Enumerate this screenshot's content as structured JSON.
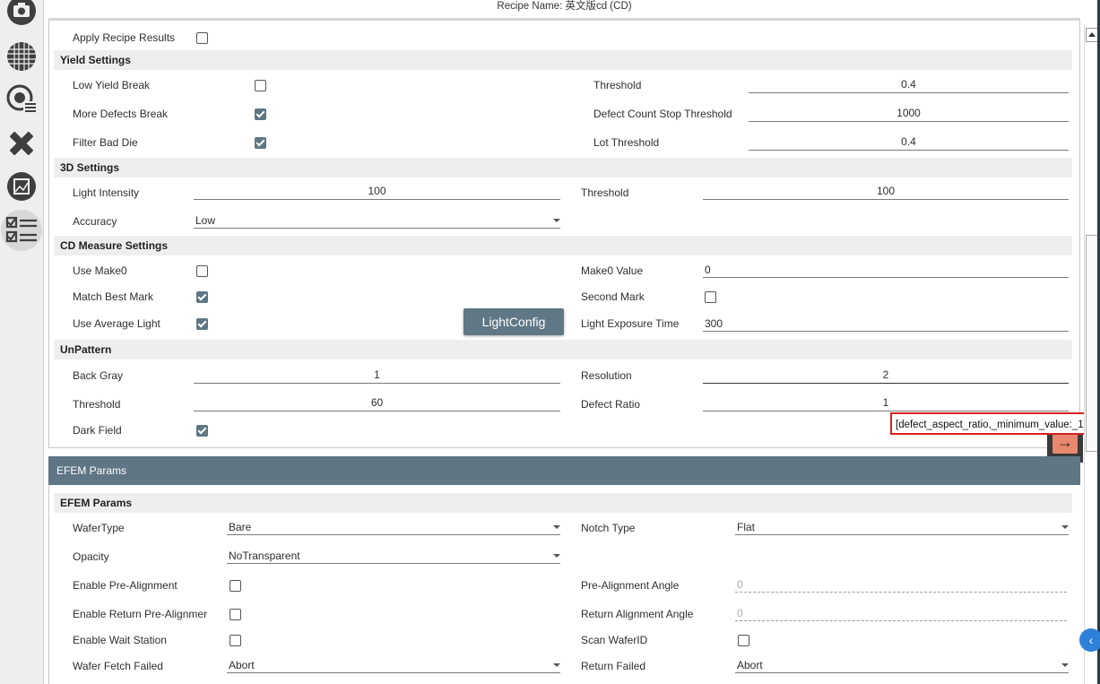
{
  "header": {
    "recipe_name": "Recipe Name: 英文版cd (CD)"
  },
  "sidebar": {
    "icons": [
      "camera-icon",
      "wafer-map-icon",
      "wafer-list-icon",
      "tools-icon",
      "image-icon",
      "checklist-icon"
    ],
    "active": "checklist-icon"
  },
  "recipe": {
    "apply_recipe_results": {
      "label": "Apply Recipe Results",
      "checked": false
    }
  },
  "yield_settings": {
    "title": "Yield Settings",
    "low_yield_break": {
      "label": "Low Yield Break",
      "checked": false
    },
    "more_defects_break": {
      "label": "More Defects Break",
      "checked": true
    },
    "filter_bad_die": {
      "label": "Filter Bad Die",
      "checked": true
    },
    "threshold": {
      "label": "Threshold",
      "value": "0.4"
    },
    "defect_count_stop_threshold": {
      "label": "Defect Count Stop Threshold",
      "value": "1000"
    },
    "lot_threshold": {
      "label": "Lot Threshold",
      "value": "0.4"
    }
  },
  "settings_3d": {
    "title": "3D Settings",
    "light_intensity": {
      "label": "Light Intensity",
      "value": "100"
    },
    "threshold": {
      "label": "Threshold",
      "value": "100"
    },
    "accuracy": {
      "label": "Accuracy",
      "value": "Low"
    }
  },
  "cd_measure": {
    "title": "CD Measure Settings",
    "use_make0": {
      "label": "Use Make0",
      "checked": false
    },
    "match_best_mark": {
      "label": "Match Best Mark",
      "checked": true
    },
    "use_average_light": {
      "label": "Use Average Light",
      "checked": true
    },
    "make0_value": {
      "label": "Make0 Value",
      "value": "0"
    },
    "second_mark": {
      "label": "Second Mark",
      "checked": false
    },
    "light_exposure_time": {
      "label": "Light Exposure Time",
      "value": "300"
    },
    "light_config_button": "LightConfig"
  },
  "unpattern": {
    "title": "UnPattern",
    "back_gray": {
      "label": "Back Gray",
      "value": "1"
    },
    "threshold": {
      "label": "Threshold",
      "value": "60"
    },
    "dark_field": {
      "label": "Dark Field",
      "checked": true
    },
    "resolution": {
      "label": "Resolution",
      "value": "2"
    },
    "defect_ratio": {
      "label": "Defect Ratio",
      "value": "1"
    }
  },
  "tooltip": "[defect_aspect_ratio,_minimum_value:_1]",
  "efem": {
    "bar_title": "EFEM Params",
    "section_title": "EFEM Params",
    "wafer_type": {
      "label": "WaferType",
      "value": "Bare"
    },
    "opacity": {
      "label": "Opacity",
      "value": "NoTransparent"
    },
    "enable_pre_alignment": {
      "label": "Enable Pre-Alignment",
      "checked": false
    },
    "enable_return_pre_alignment": {
      "label": "Enable Return Pre-Alignmer",
      "checked": false
    },
    "enable_wait_station": {
      "label": "Enable Wait Station",
      "checked": false
    },
    "wafer_fetch_failed": {
      "label": "Wafer Fetch Failed",
      "value": "Abort"
    },
    "notch_type": {
      "label": "Notch Type",
      "value": "Flat"
    },
    "pre_alignment_angle": {
      "label": "Pre-Alignment Angle",
      "value": "0"
    },
    "return_alignment_angle": {
      "label": "Return Alignment Angle",
      "value": "0"
    },
    "scan_wafer_id": {
      "label": "Scan WaferID",
      "checked": false
    },
    "return_failed": {
      "label": "Return Failed",
      "value": "Abort"
    }
  }
}
